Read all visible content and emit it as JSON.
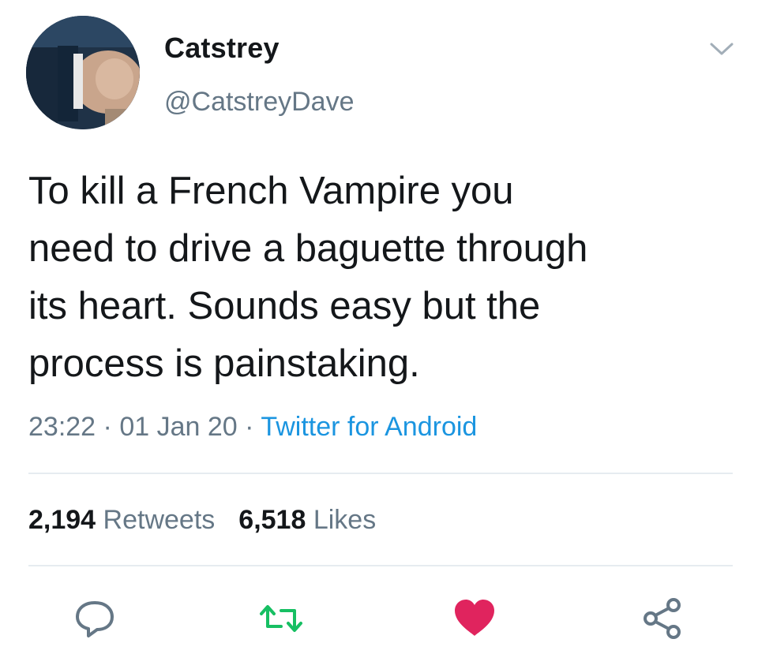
{
  "author": {
    "display_name": "Catstrey",
    "handle": "@CatstreyDave"
  },
  "tweet": {
    "text_lines": [
      "To kill a French Vampire you",
      "need to drive a baguette through",
      "its heart. Sounds easy but the",
      "process is painstaking."
    ],
    "time": "23:22",
    "separator": "·",
    "date": "01 Jan 20",
    "source": "Twitter for Android"
  },
  "stats": {
    "retweets_count": "2,194",
    "retweets_label": "Retweets",
    "likes_count": "6,518",
    "likes_label": "Likes"
  },
  "icons": {
    "more": "chevron-down-icon",
    "reply": "reply-icon",
    "retweet": "retweet-icon",
    "like": "heart-icon",
    "share": "share-icon"
  },
  "colors": {
    "text": "#14171a",
    "secondary": "#657786",
    "link": "#1b95e0",
    "retweet_green": "#17bf63",
    "like_red": "#e0245e",
    "divider": "#e6ecf0"
  }
}
